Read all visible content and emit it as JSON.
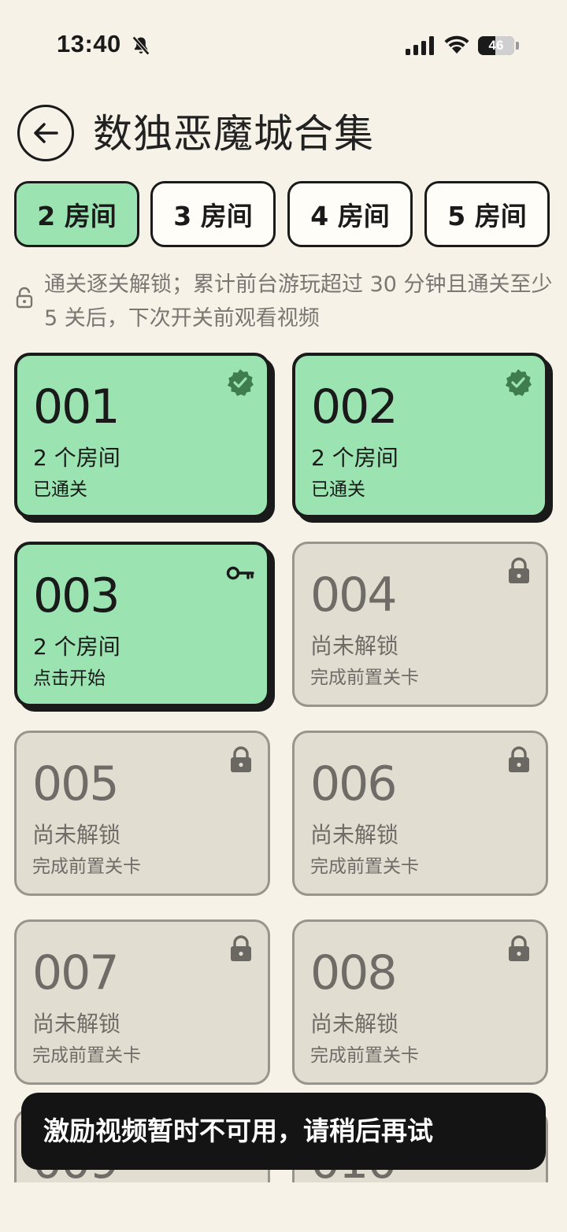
{
  "status_bar": {
    "time": "13:40",
    "battery": "46"
  },
  "header": {
    "title": "数独恶魔城合集",
    "back_icon": "arrow-left-icon"
  },
  "tabs": [
    {
      "label": "2 房间",
      "active": true
    },
    {
      "label": "3 房间",
      "active": false
    },
    {
      "label": "4 房间",
      "active": false
    },
    {
      "label": "5 房间",
      "active": false
    }
  ],
  "notice": {
    "icon": "lock-open-icon",
    "text": "通关逐关解锁；累计前台游玩超过 30 分钟且通关至少 5 关后，下次开关前观看视频"
  },
  "levels": [
    {
      "number": "001",
      "subtitle": "2 个房间",
      "status": "已通关",
      "state": "done",
      "icon": "verified-check-icon"
    },
    {
      "number": "002",
      "subtitle": "2 个房间",
      "status": "已通关",
      "state": "done",
      "icon": "verified-check-icon"
    },
    {
      "number": "003",
      "subtitle": "2 个房间",
      "status": "点击开始",
      "state": "open",
      "icon": "key-icon"
    },
    {
      "number": "004",
      "subtitle": "尚未解锁",
      "status": "完成前置关卡",
      "state": "locked",
      "icon": "lock-icon"
    },
    {
      "number": "005",
      "subtitle": "尚未解锁",
      "status": "完成前置关卡",
      "state": "locked",
      "icon": "lock-icon"
    },
    {
      "number": "006",
      "subtitle": "尚未解锁",
      "status": "完成前置关卡",
      "state": "locked",
      "icon": "lock-icon"
    },
    {
      "number": "007",
      "subtitle": "尚未解锁",
      "status": "完成前置关卡",
      "state": "locked",
      "icon": "lock-icon"
    },
    {
      "number": "008",
      "subtitle": "尚未解锁",
      "status": "完成前置关卡",
      "state": "locked",
      "icon": "lock-icon"
    },
    {
      "number": "009",
      "subtitle": "",
      "status": "",
      "state": "locked",
      "icon": "lock-icon"
    },
    {
      "number": "010",
      "subtitle": "",
      "status": "",
      "state": "locked",
      "icon": "lock-icon"
    }
  ],
  "toast": {
    "message": "激励视频暂时不可用，请稍后再试"
  },
  "colors": {
    "background": "#f6f2e8",
    "accent_green": "#9be3b0",
    "locked": "#e1ddd1",
    "check_green": "#3f7d4e"
  }
}
